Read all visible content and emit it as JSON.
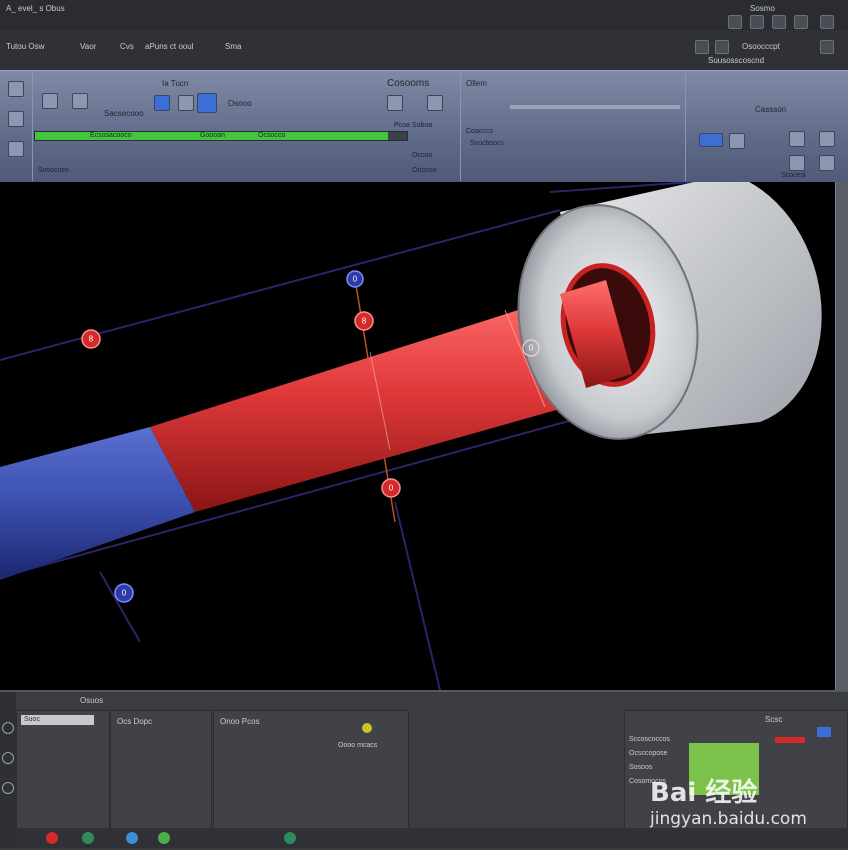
{
  "window": {
    "title_left": "A_ evel_ s  Obus",
    "title_right": "Sosmo"
  },
  "menu": {
    "items": [
      "Tutou  Osw",
      "Vaor",
      "Cvs",
      "aPuns  ct ooul",
      "Sma"
    ],
    "right_label": "Osoocccpt",
    "right_info": "Suusosscoscnd"
  },
  "ribbon": {
    "header_left": "Ia  Tucn",
    "header_mid": "Cosooms",
    "header_right": "Ollem",
    "header_far": "Cassson",
    "row1_label": "Sacsecooo",
    "row2_label": "Osooo",
    "progress_label_1": "Ecsosacooco",
    "progress_label_2": "Goooan",
    "progress_label_3": "Ocsocco",
    "progress_right": "Pcoa  Soboa",
    "progress_fraction": 0.95,
    "status_1": "Occoo",
    "status_2": "Ooosoo",
    "status_3": "Sosocoes",
    "right_label_1": "Coacccs",
    "right_label_2": "Scocbsocs",
    "far_right": "Scocesi"
  },
  "viewport": {
    "markers": [
      "8",
      "0",
      "8",
      "0",
      "0",
      "0"
    ],
    "colors": {
      "background": "#000000",
      "rod_blue": "#3b4fae",
      "rod_red": "#e0393a",
      "cap_gray": "#cfd2d6",
      "marker_red": "#d42a2a",
      "marker_blue": "#2b3ca8",
      "guide_line": "#2b2466"
    }
  },
  "bottom": {
    "header_label": "Osuos",
    "input_value": "Suoc",
    "group1_title": "Ocs  Dopc",
    "group2_title": "Onoo  Pcos",
    "group2_caption": "Oooo  mcacs",
    "right_rows": [
      "Sccoscnccos",
      "Ocsccopose",
      "Sosoos",
      "Cosomocos"
    ],
    "right_header": "Scsc"
  },
  "watermark": {
    "brand": "Bai  经验",
    "url": "jingyan.baidu.com"
  }
}
